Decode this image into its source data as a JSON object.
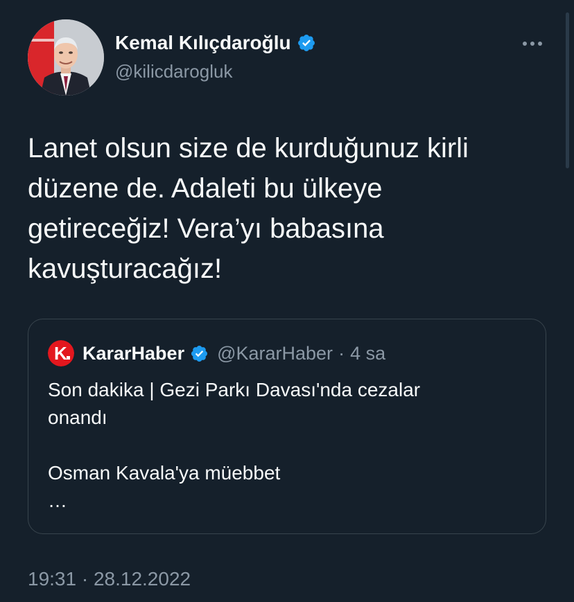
{
  "author": {
    "name": "Kemal Kılıçdaroğlu",
    "handle": "@kilicdarogluk",
    "verified": true
  },
  "tweet": {
    "text": "Lanet olsun size de kurduğunuz kirli\ndüzene de. Adaleti bu ülkeye\ngetireceğiz! Vera’yı babasına\nkavuşturacağız!"
  },
  "quote": {
    "logo_letter": "K",
    "name": "KararHaber",
    "verified": true,
    "handle": "@KararHaber",
    "separator": "·",
    "time": "4 sa",
    "text": "Son dakika | Gezi Parkı Davası'nda cezalar\nonandı\n\nOsman Kavala'ya müebbet\n…"
  },
  "timestamp": "19:31 · 28.12.2022",
  "icons": {
    "verified": "verified-badge-icon",
    "more": "more-options-icon"
  },
  "colors": {
    "background": "#15202b",
    "border": "#38444d",
    "secondary_text": "#8b98a5",
    "verified_blue": "#1d9bf0",
    "karar_red": "#e3171e"
  }
}
